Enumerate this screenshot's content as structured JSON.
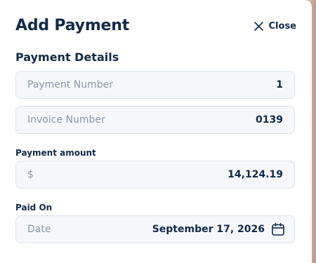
{
  "header": {
    "title": "Add Payment",
    "close_label": "Close"
  },
  "section": {
    "title": "Payment Details"
  },
  "fields": {
    "payment_number": {
      "placeholder": "Payment Number",
      "value": "1"
    },
    "invoice_number": {
      "placeholder": "Invoice Number",
      "value": "0139"
    },
    "amount": {
      "label": "Payment amount",
      "prefix": "$",
      "value": "14,124.19"
    },
    "paid_on": {
      "label": "Paid On",
      "placeholder": "Date",
      "value": "September 17, 2026"
    }
  },
  "icons": {
    "close": "close-icon",
    "calendar": "calendar-icon"
  },
  "colors": {
    "text_primary": "#122a48",
    "placeholder": "#8b97a6",
    "field_bg": "#f5f7fa",
    "field_border": "#dde3ea",
    "backdrop": "#b99b90"
  }
}
